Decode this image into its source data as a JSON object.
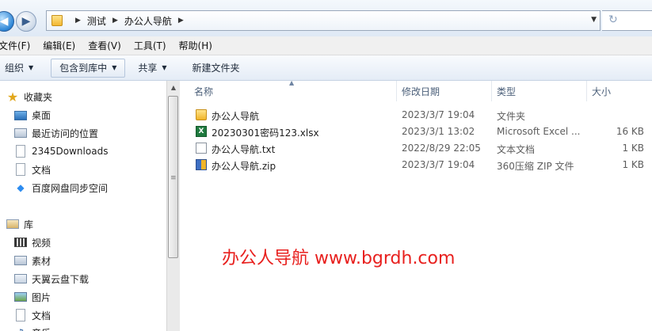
{
  "address": {
    "breadcrumbs": [
      "测试",
      "办公人导航"
    ]
  },
  "menu": [
    "文件(F)",
    "编辑(E)",
    "查看(V)",
    "工具(T)",
    "帮助(H)"
  ],
  "commands": {
    "organize": "组织",
    "include_library": "包含到库中",
    "share": "共享",
    "new_folder": "新建文件夹"
  },
  "nav": {
    "favorites": {
      "label": "收藏夹",
      "items": [
        "桌面",
        "最近访问的位置",
        "2345Downloads",
        "文档",
        "百度网盘同步空间"
      ]
    },
    "libraries": {
      "label": "库",
      "items": [
        "视频",
        "素材",
        "天翼云盘下载",
        "图片",
        "文档",
        "音乐"
      ]
    }
  },
  "columns": {
    "name": "名称",
    "date": "修改日期",
    "type": "类型",
    "size": "大小"
  },
  "files": [
    {
      "name": "办公人导航",
      "date": "2023/3/7 19:04",
      "type": "文件夹",
      "size": "",
      "icon": "folder-icon"
    },
    {
      "name": "20230301密码123.xlsx",
      "date": "2023/3/1 13:02",
      "type": "Microsoft Excel ...",
      "size": "16 KB",
      "icon": "excel-file-icon"
    },
    {
      "name": "办公人导航.txt",
      "date": "2022/8/29 22:05",
      "type": "文本文档",
      "size": "1 KB",
      "icon": "text-file-icon"
    },
    {
      "name": "办公人导航.zip",
      "date": "2023/3/7 19:04",
      "type": "360压缩 ZIP 文件",
      "size": "1 KB",
      "icon": "zip-file-icon"
    }
  ],
  "watermark": "办公人导航 www.bgrdh.com",
  "colors": {
    "watermark": "#e8201e",
    "accent": "#2e86d6"
  }
}
